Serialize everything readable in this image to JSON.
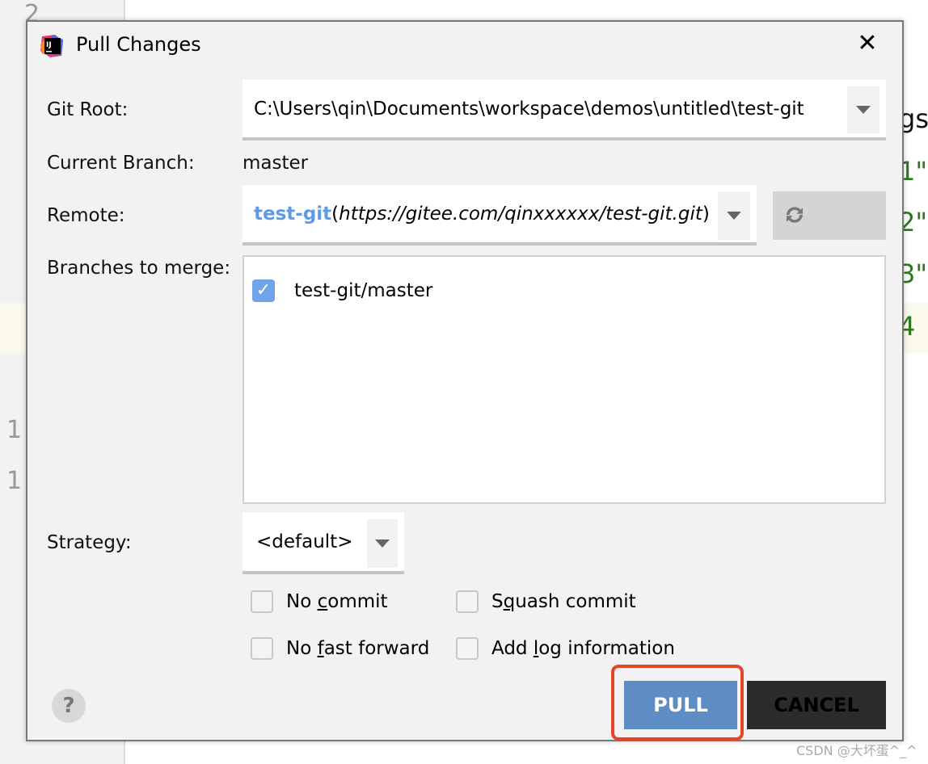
{
  "background": {
    "gutter_numbers": [
      "2",
      "1",
      "1"
    ],
    "code_fragments": [
      "gs",
      "1\"",
      "2\"",
      "3\"",
      "4"
    ],
    "watermark": "CSDN @大坏蛋^_^"
  },
  "dialog": {
    "title": "Pull Changes",
    "app_icon": "intellij-idea-icon",
    "git_root": {
      "label": "Git Root:",
      "value": "C:\\Users\\qin\\Documents\\workspace\\demos\\untitled\\test-git"
    },
    "current_branch": {
      "label": "Current Branch:",
      "value": "master"
    },
    "remote": {
      "label": "Remote:",
      "name": "test-git",
      "open": "(",
      "url": "https://gitee.com/qinxxxxxx/test-git.git",
      "close": ")"
    },
    "branches": {
      "label": "Branches to merge:",
      "items": [
        {
          "name": "test-git/master",
          "checked": true
        }
      ]
    },
    "strategy": {
      "label": "Strategy:",
      "value": "<default>"
    },
    "options": [
      {
        "pre": "No ",
        "key": "c",
        "post": "ommit",
        "checked": false
      },
      {
        "pre": "S",
        "key": "q",
        "post": "uash commit",
        "checked": false
      },
      {
        "pre": "No ",
        "key": "f",
        "post": "ast forward",
        "checked": false
      },
      {
        "pre": "Add ",
        "key": "l",
        "post": "og information",
        "checked": false
      }
    ],
    "help_label": "?",
    "pull_label": "PULL",
    "cancel_label": "CANCEL",
    "colors": {
      "accent": "#5e8cc4",
      "checkbox": "#6fa4e8",
      "remote_name": "#5e9ae6",
      "highlight": "#e8442c"
    }
  }
}
